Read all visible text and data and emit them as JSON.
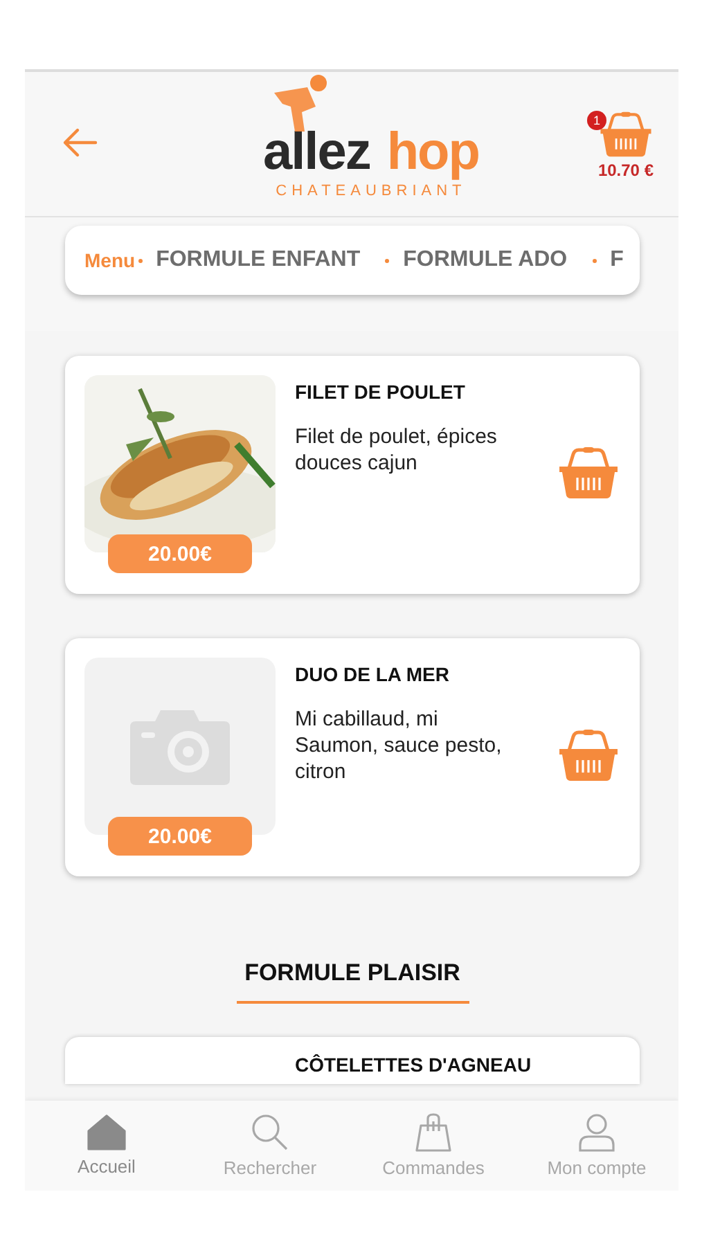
{
  "header": {
    "logo": {
      "word_1": "allez",
      "word_2": "hop",
      "tagline": "CHATEAUBRIANT"
    },
    "cart": {
      "count": "1",
      "total": "10.70 €"
    }
  },
  "category_tabs": [
    {
      "label": "Menu",
      "selected": true
    },
    {
      "label": "FORMULE ENFANT",
      "selected": false
    },
    {
      "label": "FORMULE ADO",
      "selected": false
    },
    {
      "label": "F",
      "selected": false
    }
  ],
  "products": [
    {
      "name": "FILET DE POULET",
      "description": "Filet de poulet, épices douces cajun",
      "price": "20.00€",
      "kind": "picture"
    },
    {
      "name": "DUO DE LA MER",
      "description": "Mi cabillaud, mi Saumon, sauce pesto, citron",
      "price": "20.00€",
      "kind": "placeholder"
    }
  ],
  "section": {
    "title": "FORMULE PLAISIR",
    "products": [
      {
        "name": "CÔTELETTES D'AGNEAU"
      }
    ]
  },
  "bottom_nav": [
    {
      "label": "Accueil",
      "selected": true
    },
    {
      "label": "Rechercher",
      "selected": false
    },
    {
      "label": "Commandes",
      "selected": false
    },
    {
      "label": "Mon compte",
      "selected": false
    }
  ]
}
